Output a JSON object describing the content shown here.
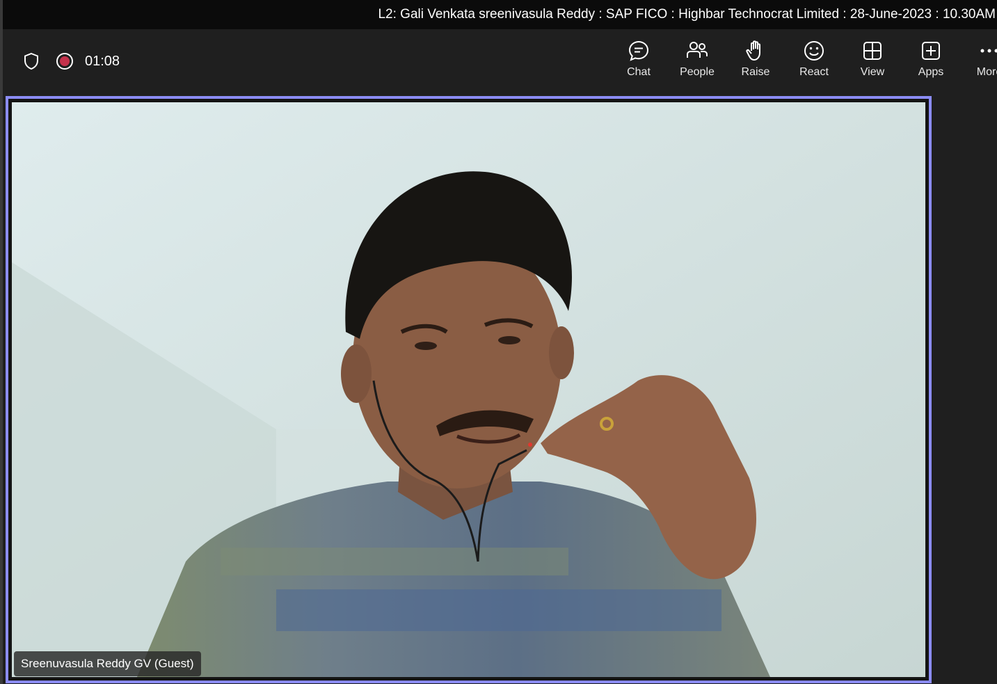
{
  "window": {
    "title": "L2: Gali Venkata sreenivasula Reddy : SAP FICO : Highbar Technocrat Limited : 28-June-2023 : 10.30AM"
  },
  "status": {
    "shield_icon": "shield-icon",
    "recording_icon": "recording-icon",
    "timer": "01:08"
  },
  "actions": [
    {
      "label": "Chat",
      "icon": "chat-icon"
    },
    {
      "label": "People",
      "icon": "people-icon"
    },
    {
      "label": "Raise",
      "icon": "raise-hand-icon"
    },
    {
      "label": "React",
      "icon": "smiley-icon"
    },
    {
      "label": "View",
      "icon": "grid-view-icon"
    },
    {
      "label": "Apps",
      "icon": "add-apps-icon"
    },
    {
      "label": "More",
      "icon": "more-icon"
    }
  ],
  "video": {
    "participant_name": "Sreenuvasula Reddy GV (Guest)",
    "active_speaker_border": "#8b8cf6"
  },
  "colors": {
    "background": "#1f1f1f",
    "title_bar": "#0b0b0b",
    "recording_red": "#c4314b"
  }
}
